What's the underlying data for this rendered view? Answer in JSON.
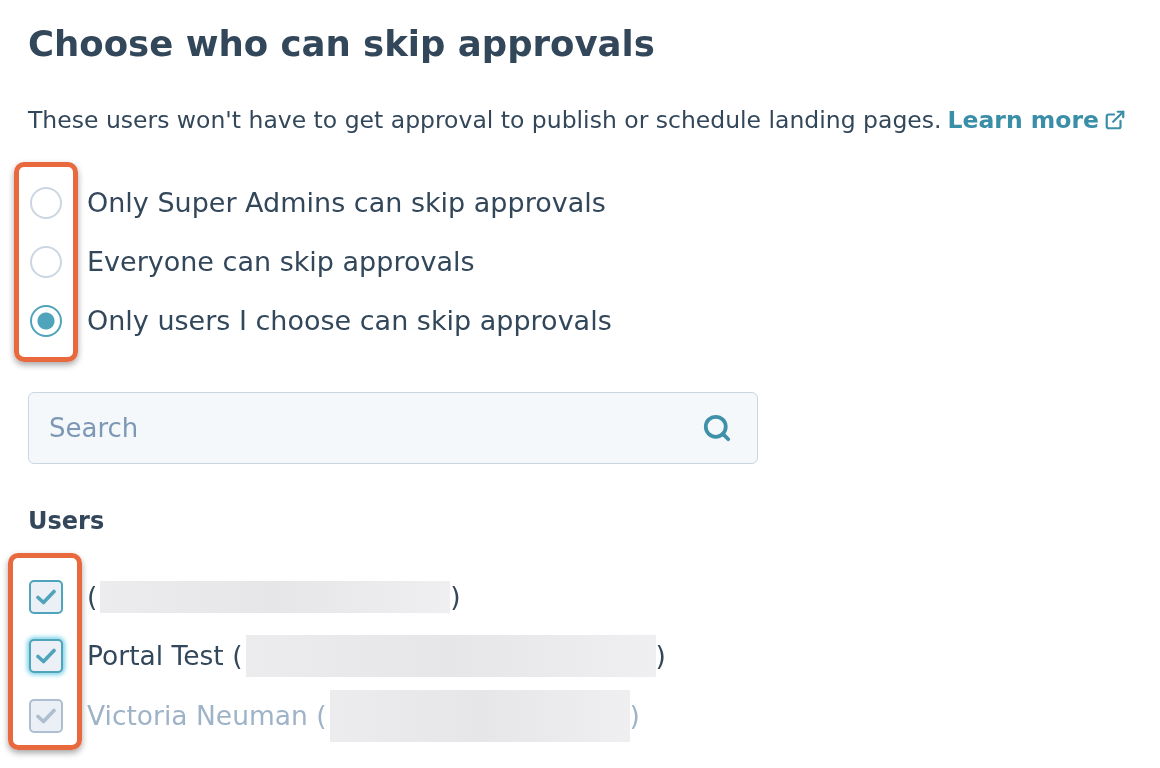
{
  "heading": "Choose who can skip approvals",
  "description": {
    "text": "These users won't have to get approval to publish or schedule landing pages.",
    "link": "Learn more"
  },
  "skip_options": {
    "highlighted": true,
    "options": [
      {
        "label": "Only Super Admins can skip approvals",
        "selected": false
      },
      {
        "label": "Everyone can skip approvals",
        "selected": false
      },
      {
        "label": "Only users I choose can skip approvals",
        "selected": true
      }
    ]
  },
  "search": {
    "placeholder": "Search"
  },
  "users": {
    "heading": "Users",
    "highlighted": true,
    "items": [
      {
        "label": "(",
        "suffix": ")",
        "checked": true,
        "focused": false,
        "disabled": false
      },
      {
        "label": "Portal Test (",
        "suffix": ")",
        "checked": true,
        "focused": true,
        "disabled": false
      },
      {
        "label": "Victoria Neuman (",
        "suffix": ")",
        "checked": true,
        "focused": false,
        "disabled": true
      }
    ]
  }
}
